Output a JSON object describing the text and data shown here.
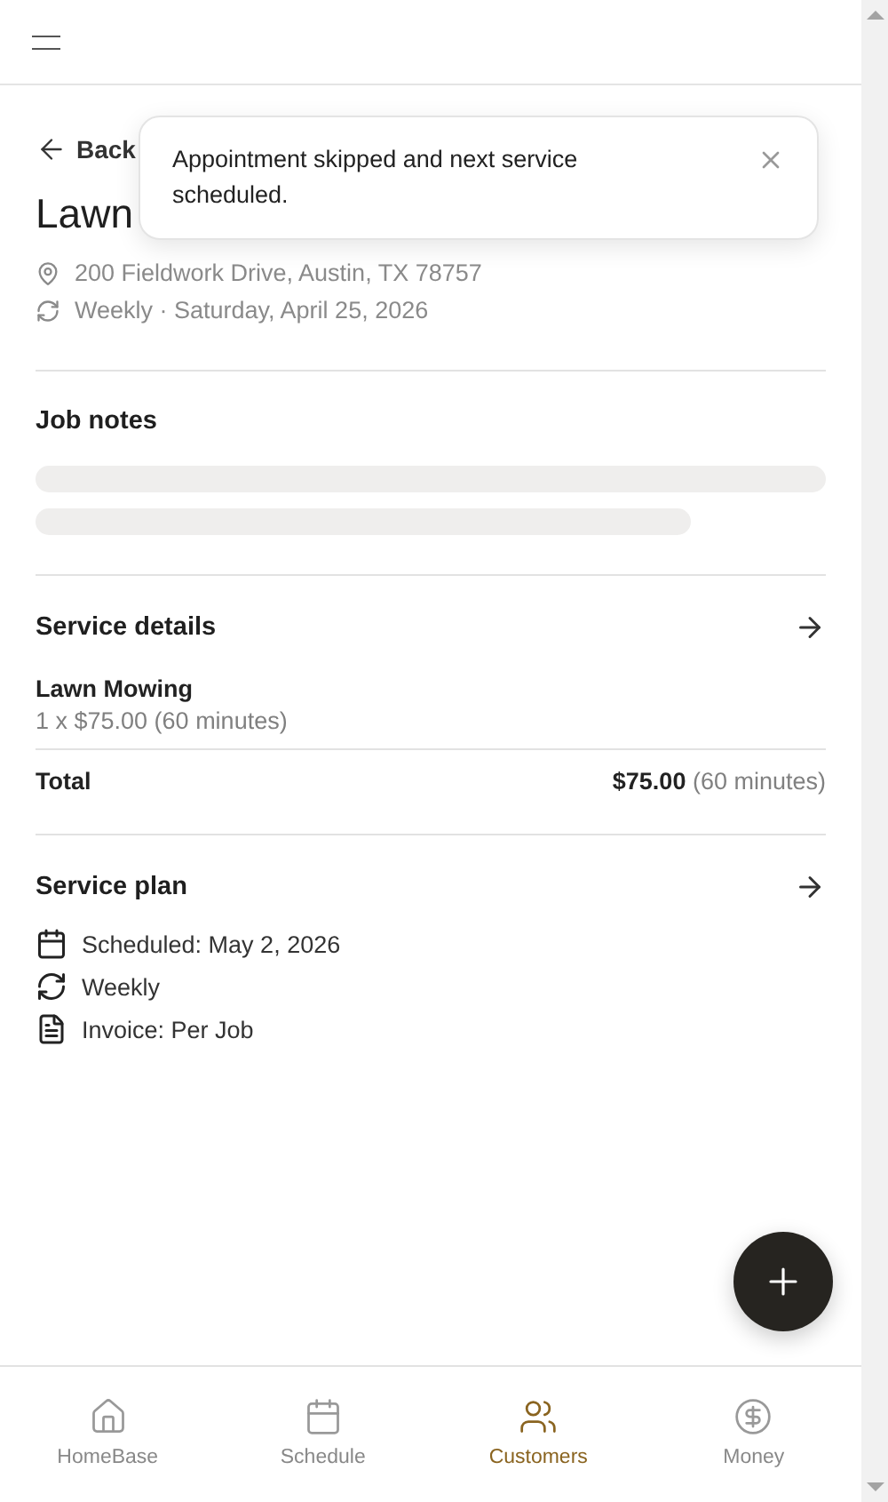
{
  "toast": {
    "message": "Appointment skipped and next service scheduled."
  },
  "back": "Back",
  "title": "Lawn",
  "meta": [
    {
      "kind": "address",
      "text": "200 Fieldwork Drive, Austin, TX 78757"
    },
    {
      "kind": "recurrence",
      "text": "Weekly · Saturday, April 25, 2026"
    }
  ],
  "job_notes": {
    "heading": "Job notes",
    "loading": true
  },
  "service_details": {
    "heading": "Service details",
    "item": {
      "name": "Lawn Mowing",
      "detail": "1 x $75.00 (60 minutes)"
    },
    "total": {
      "label": "Total",
      "amount": "$75.00",
      "duration": "(60 minutes)"
    }
  },
  "service_plan": {
    "heading": "Service plan",
    "lines": [
      {
        "kind": "calendar",
        "text": "Scheduled: May 2, 2026"
      },
      {
        "kind": "recurrence",
        "text": "Weekly"
      },
      {
        "kind": "invoice",
        "text": "Invoice: Per Job"
      }
    ]
  },
  "nav": [
    {
      "kind": "home",
      "label": "HomeBase",
      "selected": false
    },
    {
      "kind": "calendar",
      "label": "Schedule",
      "selected": false
    },
    {
      "kind": "people",
      "label": "Customers",
      "selected": true
    },
    {
      "kind": "money",
      "label": "Money",
      "selected": false
    }
  ]
}
